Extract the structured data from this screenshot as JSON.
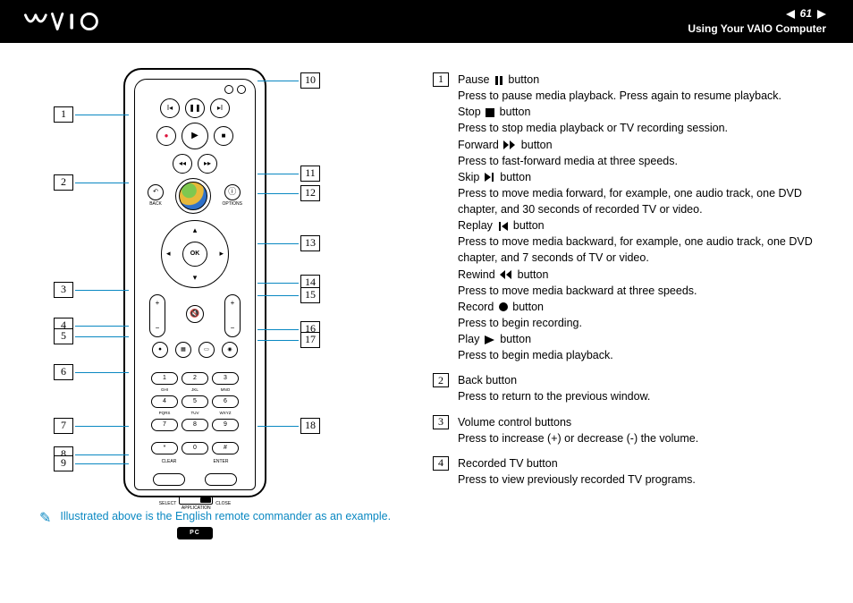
{
  "header": {
    "logo_text": "VAIO",
    "page_number": "61",
    "section": "Using Your VAIO Computer"
  },
  "remote": {
    "back_label": "BACK",
    "options_label": "OPTIONS",
    "ok_label": "OK",
    "keypad_sublabels": [
      "",
      "",
      "",
      "GHI",
      "JKL",
      "MNO",
      "PQRS",
      "TUV",
      "WXYZ",
      "",
      "",
      ""
    ],
    "keypad_keys": [
      "1",
      "2",
      "3",
      "4",
      "5",
      "6",
      "7",
      "8",
      "9",
      "*",
      "0",
      "#"
    ],
    "pill1_label": "CLEAR",
    "pill2_label": "ENTER",
    "switch_left": "SELECT",
    "switch_center": "APPLICATION",
    "switch_right": "CLOSE",
    "pc_label": "PC"
  },
  "callouts_left": [
    "1",
    "2",
    "3",
    "4",
    "5",
    "6",
    "7",
    "8",
    "9"
  ],
  "callouts_right": [
    "10",
    "11",
    "12",
    "13",
    "14",
    "15",
    "16",
    "17",
    "18"
  ],
  "descriptions": [
    {
      "num": "1",
      "lines": [
        {
          "t": "Pause ",
          "icon": "pause",
          "t2": " button"
        },
        {
          "t": "Press to pause media playback. Press again to resume playback."
        },
        {
          "t": "Stop ",
          "icon": "stop",
          "t2": " button"
        },
        {
          "t": "Press to stop media playback or TV recording session."
        },
        {
          "t": "Forward ",
          "icon": "ffwd",
          "t2": " button"
        },
        {
          "t": "Press to fast-forward media at three speeds."
        },
        {
          "t": "Skip ",
          "icon": "skip",
          "t2": " button"
        },
        {
          "t": "Press to move media forward, for example, one audio track, one DVD chapter, and 30 seconds of recorded TV or video."
        },
        {
          "t": "Replay ",
          "icon": "replay",
          "t2": " button"
        },
        {
          "t": "Press to move media backward, for example, one audio track, one DVD chapter, and 7 seconds of TV or video."
        },
        {
          "t": "Rewind ",
          "icon": "rew",
          "t2": " button"
        },
        {
          "t": "Press to move media backward at three speeds."
        },
        {
          "t": "Record ",
          "icon": "rec",
          "t2": " button"
        },
        {
          "t": "Press to begin recording."
        },
        {
          "t": "Play ",
          "icon": "play",
          "t2": " button"
        },
        {
          "t": "Press to begin media playback."
        }
      ]
    },
    {
      "num": "2",
      "lines": [
        {
          "t": "Back button"
        },
        {
          "t": "Press to return to the previous window."
        }
      ]
    },
    {
      "num": "3",
      "lines": [
        {
          "t": "Volume control buttons"
        },
        {
          "t": "Press to increase (+) or decrease (-) the volume."
        }
      ]
    },
    {
      "num": "4",
      "lines": [
        {
          "t": "Recorded TV button"
        },
        {
          "t": "Press to view previously recorded TV programs."
        }
      ]
    }
  ],
  "note": "Illustrated above is the English remote commander as an example."
}
